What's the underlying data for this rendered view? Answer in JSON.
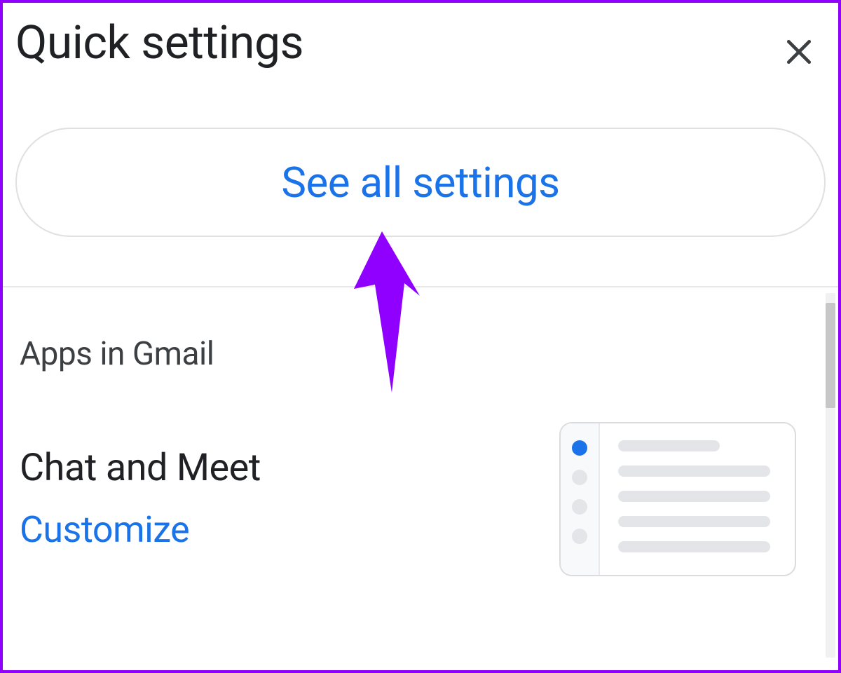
{
  "panel": {
    "title": "Quick settings",
    "see_all_label": "See all settings"
  },
  "apps_section": {
    "heading": "Apps in Gmail",
    "items": [
      {
        "title": "Chat and Meet",
        "action": "Customize"
      }
    ]
  },
  "colors": {
    "link": "#1a73e8",
    "annotation": "#8f00ff"
  }
}
